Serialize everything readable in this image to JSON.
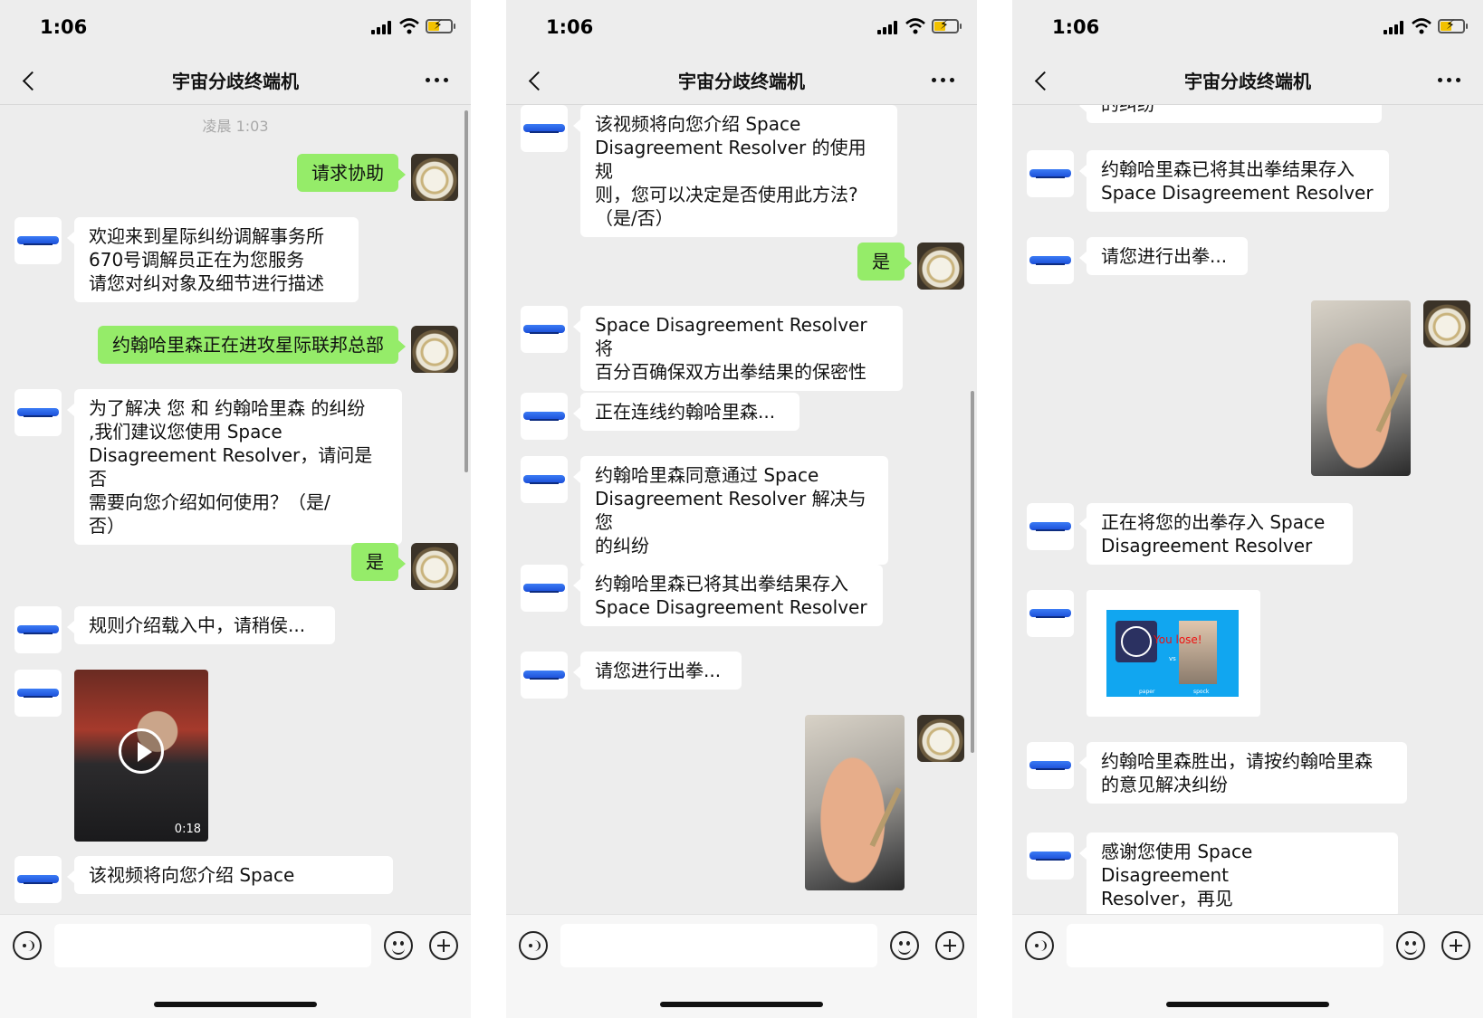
{
  "status": {
    "time": "1:06"
  },
  "nav": {
    "title": "宇宙分歧终端机"
  },
  "screen1": {
    "timestamp": "凌晨 1:03",
    "m1": "请求协助",
    "m2": "欢迎来到星际纠纷调解事务所\n670号调解员正在为您服务\n请您对纠对象及细节进行描述",
    "m3": "约翰哈里森正在进攻星际联邦总部",
    "m4": "为了解决 您 和 约翰哈里森 的纠纷\n,我们建议您使用 Space\nDisagreement Resolver，请问是否\n需要向您介绍如何使用？（是/\n否）",
    "m5": "是",
    "m6": "规则介绍载入中，请稍侯...",
    "video_duration": "0:18",
    "m7": "该视频将向您介绍 Space"
  },
  "screen2": {
    "m1": "该视频将向您介绍 Space\nDisagreement Resolver 的使用规\n则，您可以决定是否使用此方法?\n（是/否）",
    "m2": "是",
    "m3": "Space Disagreement Resolver 将\n百分百确保双方出拳结果的保密性",
    "m4": "正在连线约翰哈里森...",
    "m5": "约翰哈里森同意通过 Space\nDisagreement Resolver 解决与您\n的纠纷",
    "m6": "约翰哈里森已将其出拳结果存入\nSpace Disagreement Resolver",
    "m7": "请您进行出拳..."
  },
  "screen3": {
    "m0": "的纠纷",
    "m1": "约翰哈里森已将其出拳结果存入\nSpace Disagreement Resolver",
    "m2": "请您进行出拳...",
    "m3": "正在将您的出拳存入 Space\nDisagreement Resolver",
    "result_text": "You lose!",
    "result_vs": "vs",
    "result_left_caption": "paper",
    "result_right_caption": "spock",
    "m4": "约翰哈里森胜出，请按约翰哈里森\n的意见解决纠纷",
    "m5": "感谢您使用 Space Disagreement\nResolver，再见"
  },
  "icons": {
    "back": "chevron-left-icon",
    "more": "more-dots-icon",
    "voice": "voice-icon",
    "emoji": "emoji-icon",
    "plus": "plus-icon",
    "play": "play-icon"
  },
  "colors": {
    "background": "#ededed",
    "outgoing_bubble": "#95ec69",
    "incoming_bubble": "#ffffff",
    "timestamp": "#a8a8a8"
  }
}
